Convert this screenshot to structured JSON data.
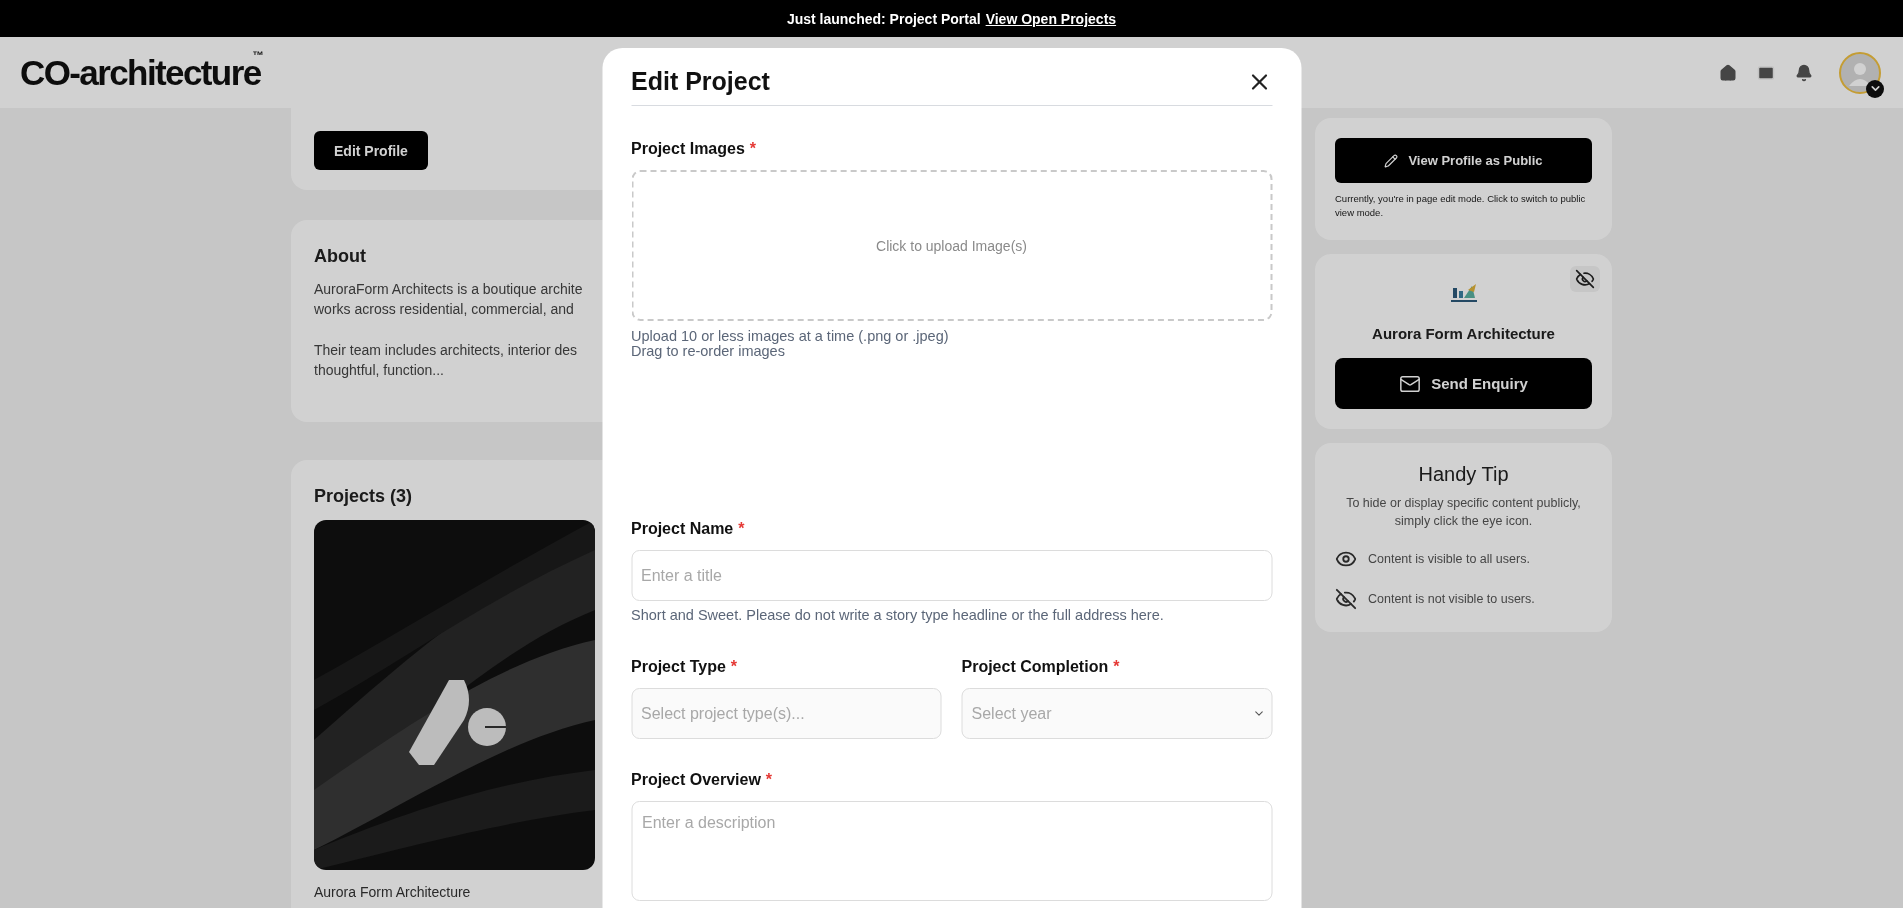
{
  "banner": {
    "text": "Just launched: Project Portal",
    "link": "View Open Projects"
  },
  "header": {
    "logo": "CO-architecture",
    "logo_mark": "™"
  },
  "profile": {
    "edit_button": "Edit Profile"
  },
  "about": {
    "title": "About",
    "paragraphs": [
      [
        "AuroraForm Architects is a boutique archite",
        "works across residential, commercial, and"
      ],
      [
        "Their team includes architects, interior des",
        "thoughtful, function..."
      ]
    ]
  },
  "projects": {
    "title": "Projects (3)",
    "items": [
      {
        "kind": "picture",
        "caption": "Aurora Form Architecture"
      }
    ]
  },
  "sidebar": {
    "public_button": "View Profile as Public",
    "public_note": "Currently, you're in page edit mode. Click to switch to public view mode.",
    "visible": false,
    "company": "Aurora Form Architecture",
    "enquiry_button": "Send Enquiry",
    "tip_title": "Handy Tip",
    "tip_text": "To hide or display specific content publicly, simply click the eye icon.",
    "legend": [
      {
        "kind": "visible",
        "text": "Content is visible to all users."
      },
      {
        "kind": "hidden",
        "text": "Content is not visible to users."
      }
    ]
  },
  "modal": {
    "title": "Edit Project",
    "fields": [
      {
        "kind": "upload",
        "label": "Project Images",
        "required_mark": "*",
        "prompt": "Click to upload Image(s)",
        "hints": [
          "Upload 10 or less images at a time (.png or .jpeg)",
          "Drag to re-order images"
        ]
      },
      {
        "kind": "text",
        "label": "Project Name",
        "required_mark": "*",
        "placeholder": "Enter a title",
        "hint": "Short and Sweet. Please do not write a story type headline or the full address here."
      },
      {
        "kind": "pair",
        "items": [
          {
            "kind": "combo",
            "label": "Project Type",
            "required_mark": "*",
            "placeholder": "Select project type(s)..."
          },
          {
            "kind": "select",
            "label": "Project Completion",
            "required_mark": "*",
            "prompt": "Select year"
          }
        ]
      },
      {
        "kind": "textarea",
        "label": "Project Overview",
        "required_mark": "*",
        "placeholder": "Enter a description"
      }
    ]
  }
}
